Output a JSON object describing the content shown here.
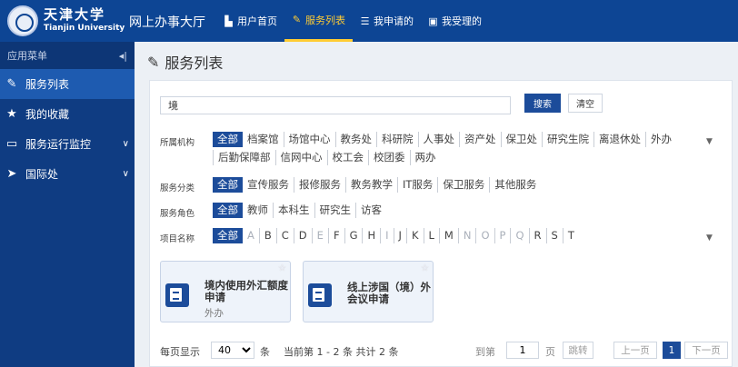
{
  "header": {
    "brand_cn": "天津大学",
    "brand_en": "Tianjin University",
    "app_title": "网上办事大厅",
    "nav": [
      {
        "icon": "home-icon",
        "glyph": "▙",
        "label": "用户首页"
      },
      {
        "icon": "edit-icon",
        "glyph": "✎",
        "label": "服务列表"
      },
      {
        "icon": "list-icon",
        "glyph": "☰",
        "label": "我申请的"
      },
      {
        "icon": "inbox-icon",
        "glyph": "▣",
        "label": "我受理的"
      }
    ],
    "active_nav": 1
  },
  "sidebar": {
    "title": "应用菜单",
    "collapse_glyph": "◂|",
    "items": [
      {
        "icon": "edit-icon",
        "glyph": "✎",
        "label": "服务列表",
        "active": true
      },
      {
        "icon": "star-icon",
        "glyph": "★",
        "label": "我的收藏"
      },
      {
        "icon": "folder-icon",
        "glyph": "▭",
        "label": "服务运行监控",
        "chevron": "∨"
      },
      {
        "icon": "send-icon",
        "glyph": "➤",
        "label": "国际处",
        "chevron": "∨"
      }
    ]
  },
  "page": {
    "title": "服务列表",
    "title_glyph": "✎"
  },
  "search": {
    "value": "境",
    "search_button": "搜索",
    "clear_button": "清空"
  },
  "filters": {
    "org": {
      "label": "所属机构",
      "options": [
        "全部",
        "档案馆",
        "场馆中心",
        "教务处",
        "科研院",
        "人事处",
        "资产处",
        "保卫处",
        "研究生院",
        "离退休处",
        "外办",
        "后勤保障部",
        "信网中心",
        "校工会",
        "校团委",
        "两办"
      ]
    },
    "category": {
      "label": "服务分类",
      "options": [
        "全部",
        "宣传服务",
        "报修服务",
        "教务教学",
        "IT服务",
        "保卫服务",
        "其他服务"
      ]
    },
    "role": {
      "label": "服务角色",
      "options": [
        "全部",
        "教师",
        "本科生",
        "研究生",
        "访客"
      ]
    },
    "name": {
      "label": "项目名称",
      "options": [
        "全部",
        "A",
        "B",
        "C",
        "D",
        "E",
        "F",
        "G",
        "H",
        "I",
        "J",
        "K",
        "L",
        "M",
        "N",
        "O",
        "P",
        "Q",
        "R",
        "S",
        "T"
      ],
      "dim": [
        "A",
        "E",
        "I",
        "N",
        "O",
        "P",
        "Q"
      ]
    },
    "more_glyph": "▼"
  },
  "cards": [
    {
      "title": "境内使用外汇额度申请",
      "sub": "外办"
    },
    {
      "title": "线上涉国（境）外会议申请",
      "sub": ""
    }
  ],
  "pagination": {
    "per_page_label": "每页显示",
    "page_size": "40",
    "unit": "条",
    "summary": "当前第 1 - 2 条 共计 2 条",
    "goto_label": "到第",
    "goto_value": "1",
    "page_unit": "页",
    "jump": "跳转",
    "prev": "上一页",
    "current": "1",
    "next": "下一页"
  }
}
